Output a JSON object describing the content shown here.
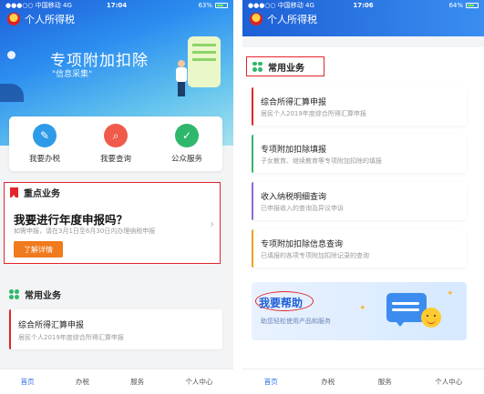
{
  "left": {
    "status": {
      "carrier": "●●●○○ 中国移动  4G",
      "time": "17:04",
      "battery": "63%"
    },
    "app_title": "个人所得税",
    "hero": {
      "title": "专项附加扣除",
      "subtitle": "\"信息采集\""
    },
    "quick_actions": [
      {
        "label": "我要办税",
        "icon": "pencil-icon",
        "color": "#2e9be8",
        "glyph": "✎"
      },
      {
        "label": "我要查询",
        "icon": "search-icon",
        "color": "#f05a4a",
        "glyph": "⌕"
      },
      {
        "label": "公众服务",
        "icon": "service-icon",
        "color": "#2fb86c",
        "glyph": "✓"
      }
    ],
    "key_business": {
      "heading": "重点业务",
      "question": "我要进行年度申报吗？",
      "note": "如需申报，请在3月1日至6月30日内办理纳税申报",
      "button": "了解详情"
    },
    "common_heading": "常用业务",
    "common_items": [
      {
        "title": "综合所得汇算申报",
        "subtitle": "居民个人2019年度综合所得汇算申报",
        "accent": "#e2252b"
      }
    ],
    "tabs": [
      "首页",
      "办税",
      "服务",
      "个人中心"
    ],
    "active_tab": "首页"
  },
  "right": {
    "status": {
      "carrier": "●●●○○ 中国移动  4G",
      "time": "17:06",
      "battery": "64%"
    },
    "app_title": "个人所得税",
    "common_heading": "常用业务",
    "items": [
      {
        "title": "综合所得汇算申报",
        "subtitle": "居民个人2019年度综合所得汇算申报",
        "accent": "#e2252b"
      },
      {
        "title": "专项附加扣除填报",
        "subtitle": "子女教育、继续教育等专项附加扣除的填报",
        "accent": "#2fb86c"
      },
      {
        "title": "收入纳税明细查询",
        "subtitle": "已申报收入的查询及异议申诉",
        "accent": "#8e6ad8"
      },
      {
        "title": "专项附加扣除信息查询",
        "subtitle": "已填报的各项专项附加扣除记录的查询",
        "accent": "#f0a21e"
      }
    ],
    "help": {
      "title": "我要帮助",
      "subtitle": "助您轻松使用产品和服务"
    },
    "tabs": [
      "首页",
      "办税",
      "服务",
      "个人中心"
    ],
    "active_tab": "首页"
  },
  "colors": {
    "brand_blue": "#2a6ee8",
    "highlight_red": "#e2252b",
    "orange": "#f07a1e",
    "green": "#2fb86c"
  }
}
